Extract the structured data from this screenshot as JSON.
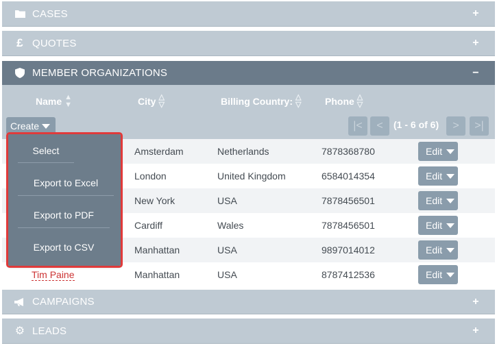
{
  "panels": {
    "cases": {
      "title": "CASES",
      "toggle": "+"
    },
    "quotes": {
      "title": "QUOTES",
      "toggle": "+"
    },
    "member": {
      "title": "MEMBER ORGANIZATIONS",
      "toggle": "−"
    },
    "campaigns": {
      "title": "CAMPAIGNS",
      "toggle": "+"
    },
    "leads": {
      "title": "LEADS",
      "toggle": "+"
    }
  },
  "columns": {
    "name": "Name",
    "city": "City",
    "country": "Billing Country:",
    "phone": "Phone"
  },
  "toolbar": {
    "create_label": "Create",
    "pagination_label": "(1 - 6 of 6)"
  },
  "dropdown": {
    "items": [
      "Select",
      "Export to Excel",
      "Export to PDF",
      "Export to CSV"
    ]
  },
  "rows": [
    {
      "name": "",
      "city": "Amsterdam",
      "country": "Netherlands",
      "phone": "7878368780",
      "edit": "Edit"
    },
    {
      "name": "",
      "city": "London",
      "country": "United Kingdom",
      "phone": "6584014354",
      "edit": "Edit"
    },
    {
      "name": "",
      "city": "New York",
      "country": "USA",
      "phone": "7878456501",
      "edit": "Edit"
    },
    {
      "name": "",
      "city": "Cardiff",
      "country": "Wales",
      "phone": "7878456501",
      "edit": "Edit"
    },
    {
      "name": "",
      "city": "Manhattan",
      "country": "USA",
      "phone": "9897014012",
      "edit": "Edit"
    },
    {
      "name": "Tim Paine",
      "city": "Manhattan",
      "country": "USA",
      "phone": "8787412536",
      "edit": "Edit"
    }
  ],
  "icons": {
    "cases": "folder-icon",
    "quotes": "pound-icon",
    "member": "shield-icon",
    "campaigns": "megaphone-icon",
    "leads": "gear-icon"
  },
  "colors": {
    "panel_header": "#bfcad3",
    "active_header": "#6b7b8a",
    "dropdown_bg": "#6d7d8b",
    "highlight_border": "#e03a3a",
    "link": "#cc3333"
  }
}
